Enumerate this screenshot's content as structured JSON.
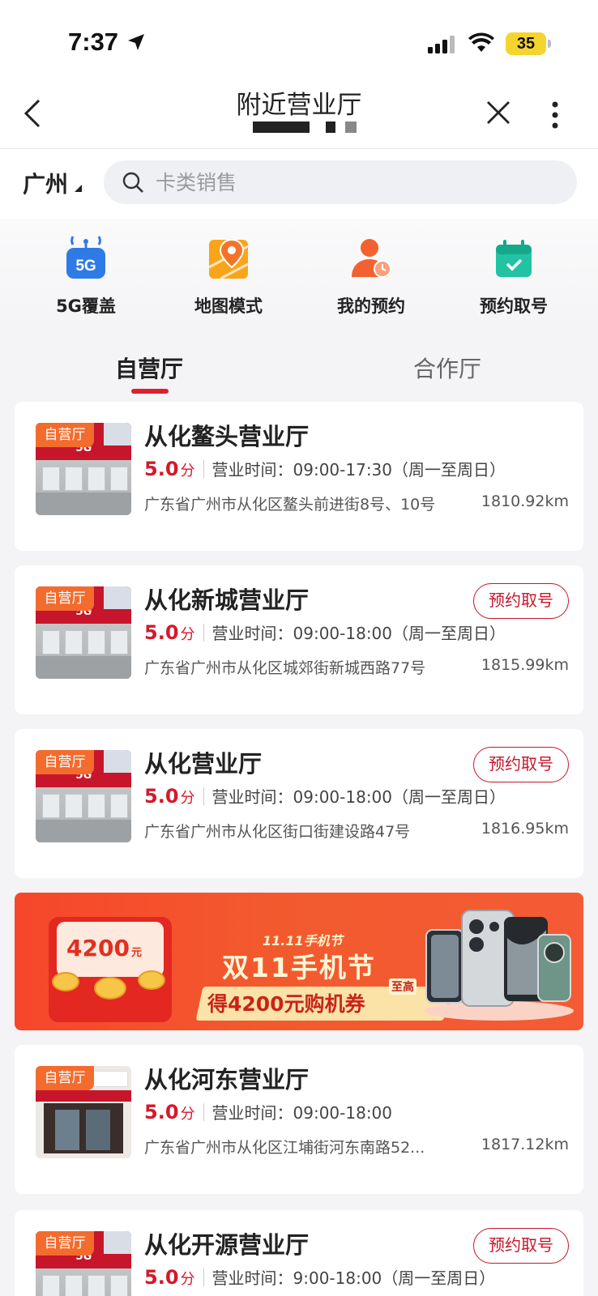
{
  "status_bar": {
    "time": "7:37",
    "battery": "35"
  },
  "nav": {
    "title": "附近营业厅"
  },
  "search": {
    "city": "广州",
    "placeholder": "卡类销售"
  },
  "quick_actions": [
    {
      "label": "5G覆盖",
      "icon": "5g-coverage-icon"
    },
    {
      "label": "地图模式",
      "icon": "map-mode-icon"
    },
    {
      "label": "我的预约",
      "icon": "my-appointment-icon"
    },
    {
      "label": "预约取号",
      "icon": "reserve-number-icon"
    }
  ],
  "tabs": [
    {
      "label": "自营厅",
      "active": true
    },
    {
      "label": "合作厅",
      "active": false
    }
  ],
  "stores": [
    {
      "badge": "自营厅",
      "name": "从化鳌头营业厅",
      "score": "5.0",
      "score_unit": "分",
      "hours": "营业时间：09:00-17:30（周一至周日）",
      "address": "广东省广州市从化区鳌头前进街8号、10号",
      "distance": "1810.92km",
      "button": ""
    },
    {
      "badge": "自营厅",
      "name": "从化新城营业厅",
      "score": "5.0",
      "score_unit": "分",
      "hours": "营业时间：09:00-18:00（周一至周日）",
      "address": "广东省广州市从化区城郊街新城西路77号",
      "distance": "1815.99km",
      "button": "预约取号"
    },
    {
      "badge": "自营厅",
      "name": "从化营业厅",
      "score": "5.0",
      "score_unit": "分",
      "hours": "营业时间：09:00-18:00（周一至周日）",
      "address": "广东省广州市从化区街口街建设路47号",
      "distance": "1816.95km",
      "button": "预约取号"
    },
    {
      "badge": "自营厅",
      "name": "从化河东营业厅",
      "score": "5.0",
      "score_unit": "分",
      "hours": "营业时间：09:00-18:00",
      "address": "广东省广州市从化区江埔街河东南路52...",
      "distance": "1817.12km",
      "button": ""
    },
    {
      "badge": "自营厅",
      "name": "从化开源营业厅",
      "score": "5.0",
      "score_unit": "分",
      "hours": "营业时间：9:00-18:00（周一至周日）",
      "address": "",
      "distance": "",
      "button": "预约取号"
    }
  ],
  "banner": {
    "amount": "4200",
    "amount_unit": "元",
    "subtitle": "11.11手机节",
    "title": "双11手机节",
    "ribbon": "得4200元购机券",
    "ribbon_tag": "至高"
  },
  "colors": {
    "brand_red": "#d6182b",
    "badge_orange": "#f36c2e",
    "accent_blue": "#2f7be6"
  }
}
